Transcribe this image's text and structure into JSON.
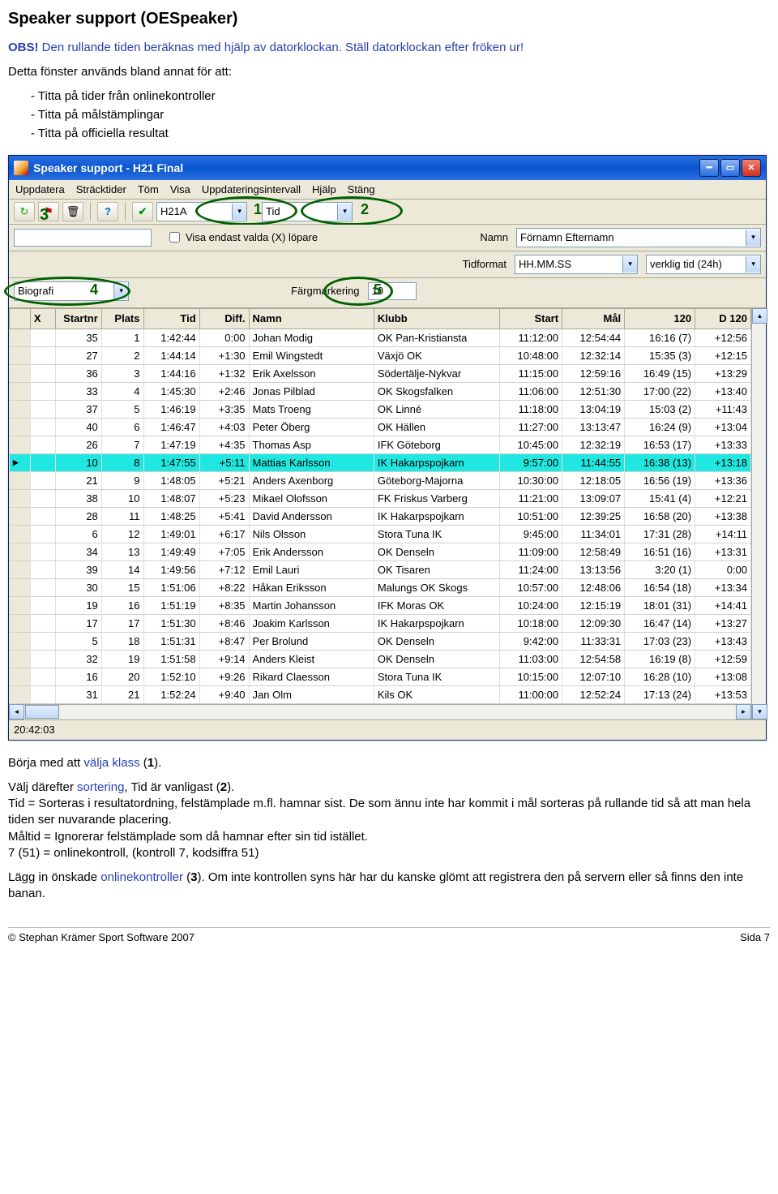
{
  "header": {
    "title": "Speaker support (OESpeaker)",
    "intro_prefix": "OBS!",
    "intro": " Den rullande tiden beräknas med hjälp av datorklockan. Ställ datorklockan efter fröken ur!",
    "para2": "Detta fönster används bland annat för att:",
    "bullets": [
      "Titta på tider från onlinekontroller",
      "Titta på målstämplingar",
      "Titta på officiella resultat"
    ]
  },
  "window": {
    "title": "Speaker support - H21 Final",
    "menu": [
      "Uppdatera",
      "Sträcktider",
      "Töm",
      "Visa",
      "Uppdateringsintervall",
      "Hjälp",
      "Stäng"
    ],
    "class_value": "H21A",
    "sort_value": "Tid",
    "filter_value": "",
    "chk_label": "Visa endast valda (X) löpare",
    "namn_label": "Namn",
    "namn_value": "Förnamn Efternamn",
    "tidformat_label": "Tidformat",
    "tidformat_value": "HH.MM.SS",
    "tid_mode_value": "verklig tid (24h)",
    "biografi_label": "Biografi",
    "farg_label": "Färgmarkering",
    "farg_value": "10",
    "status_time": "20:42:03",
    "columns": [
      "X",
      "Startnr",
      "Plats",
      "Tid",
      "Diff.",
      "Namn",
      "Klubb",
      "Start",
      "Mål",
      "120",
      "D 120"
    ],
    "rows": [
      {
        "sn": 35,
        "pl": 1,
        "tid": "1:42:44",
        "diff": "0:00",
        "namn": "Johan Modig",
        "klubb": "OK Pan-Kristiansta",
        "start": "11:12:00",
        "mal": "12:54:44",
        "c120": "16:16 (7)",
        "d120": "+12:56"
      },
      {
        "sn": 27,
        "pl": 2,
        "tid": "1:44:14",
        "diff": "+1:30",
        "namn": "Emil Wingstedt",
        "klubb": "Växjö OK",
        "start": "10:48:00",
        "mal": "12:32:14",
        "c120": "15:35 (3)",
        "d120": "+12:15"
      },
      {
        "sn": 36,
        "pl": 3,
        "tid": "1:44:16",
        "diff": "+1:32",
        "namn": "Erik Axelsson",
        "klubb": "Södertälje-Nykvar",
        "start": "11:15:00",
        "mal": "12:59:16",
        "c120": "16:49 (15)",
        "d120": "+13:29"
      },
      {
        "sn": 33,
        "pl": 4,
        "tid": "1:45:30",
        "diff": "+2:46",
        "namn": "Jonas Pilblad",
        "klubb": "OK Skogsfalken",
        "start": "11:06:00",
        "mal": "12:51:30",
        "c120": "17:00 (22)",
        "d120": "+13:40"
      },
      {
        "sn": 37,
        "pl": 5,
        "tid": "1:46:19",
        "diff": "+3:35",
        "namn": "Mats Troeng",
        "klubb": "OK Linné",
        "start": "11:18:00",
        "mal": "13:04:19",
        "c120": "15:03 (2)",
        "d120": "+11:43"
      },
      {
        "sn": 40,
        "pl": 6,
        "tid": "1:46:47",
        "diff": "+4:03",
        "namn": "Peter Öberg",
        "klubb": "OK Hällen",
        "start": "11:27:00",
        "mal": "13:13:47",
        "c120": "16:24 (9)",
        "d120": "+13:04"
      },
      {
        "sn": 26,
        "pl": 7,
        "tid": "1:47:19",
        "diff": "+4:35",
        "namn": "Thomas Asp",
        "klubb": "IFK Göteborg",
        "start": "10:45:00",
        "mal": "12:32:19",
        "c120": "16:53 (17)",
        "d120": "+13:33"
      },
      {
        "sn": 10,
        "pl": 8,
        "tid": "1:47:55",
        "diff": "+5:11",
        "namn": "Mattias Karlsson",
        "klubb": "IK Hakarpspojkarn",
        "start": "9:57:00",
        "mal": "11:44:55",
        "c120": "16:38 (13)",
        "d120": "+13:18",
        "sel": true
      },
      {
        "sn": 21,
        "pl": 9,
        "tid": "1:48:05",
        "diff": "+5:21",
        "namn": "Anders Axenborg",
        "klubb": "Göteborg-Majorna",
        "start": "10:30:00",
        "mal": "12:18:05",
        "c120": "16:56 (19)",
        "d120": "+13:36"
      },
      {
        "sn": 38,
        "pl": 10,
        "tid": "1:48:07",
        "diff": "+5:23",
        "namn": "Mikael Olofsson",
        "klubb": "FK Friskus Varberg",
        "start": "11:21:00",
        "mal": "13:09:07",
        "c120": "15:41 (4)",
        "d120": "+12:21"
      },
      {
        "sn": 28,
        "pl": 11,
        "tid": "1:48:25",
        "diff": "+5:41",
        "namn": "David Andersson",
        "klubb": "IK Hakarpspojkarn",
        "start": "10:51:00",
        "mal": "12:39:25",
        "c120": "16:58 (20)",
        "d120": "+13:38"
      },
      {
        "sn": 6,
        "pl": 12,
        "tid": "1:49:01",
        "diff": "+6:17",
        "namn": "Nils Olsson",
        "klubb": "Stora Tuna IK",
        "start": "9:45:00",
        "mal": "11:34:01",
        "c120": "17:31 (28)",
        "d120": "+14:11"
      },
      {
        "sn": 34,
        "pl": 13,
        "tid": "1:49:49",
        "diff": "+7:05",
        "namn": "Erik Andersson",
        "klubb": "OK Denseln",
        "start": "11:09:00",
        "mal": "12:58:49",
        "c120": "16:51 (16)",
        "d120": "+13:31"
      },
      {
        "sn": 39,
        "pl": 14,
        "tid": "1:49:56",
        "diff": "+7:12",
        "namn": "Emil Lauri",
        "klubb": "OK Tisaren",
        "start": "11:24:00",
        "mal": "13:13:56",
        "c120": "3:20 (1)",
        "d120": "0:00"
      },
      {
        "sn": 30,
        "pl": 15,
        "tid": "1:51:06",
        "diff": "+8:22",
        "namn": "Håkan Eriksson",
        "klubb": "Malungs OK Skogs",
        "start": "10:57:00",
        "mal": "12:48:06",
        "c120": "16:54 (18)",
        "d120": "+13:34"
      },
      {
        "sn": 19,
        "pl": 16,
        "tid": "1:51:19",
        "diff": "+8:35",
        "namn": "Martin Johansson",
        "klubb": "IFK Moras OK",
        "start": "10:24:00",
        "mal": "12:15:19",
        "c120": "18:01 (31)",
        "d120": "+14:41"
      },
      {
        "sn": 17,
        "pl": 17,
        "tid": "1:51:30",
        "diff": "+8:46",
        "namn": "Joakim Karlsson",
        "klubb": "IK Hakarpspojkarn",
        "start": "10:18:00",
        "mal": "12:09:30",
        "c120": "16:47 (14)",
        "d120": "+13:27"
      },
      {
        "sn": 5,
        "pl": 18,
        "tid": "1:51:31",
        "diff": "+8:47",
        "namn": "Per Brolund",
        "klubb": "OK Denseln",
        "start": "9:42:00",
        "mal": "11:33:31",
        "c120": "17:03 (23)",
        "d120": "+13:43"
      },
      {
        "sn": 32,
        "pl": 19,
        "tid": "1:51:58",
        "diff": "+9:14",
        "namn": "Anders Kleist",
        "klubb": "OK Denseln",
        "start": "11:03:00",
        "mal": "12:54:58",
        "c120": "16:19 (8)",
        "d120": "+12:59"
      },
      {
        "sn": 16,
        "pl": 20,
        "tid": "1:52:10",
        "diff": "+9:26",
        "namn": "Rikard Claesson",
        "klubb": "Stora Tuna IK",
        "start": "10:15:00",
        "mal": "12:07:10",
        "c120": "16:28 (10)",
        "d120": "+13:08"
      },
      {
        "sn": 31,
        "pl": 21,
        "tid": "1:52:24",
        "diff": "+9:40",
        "namn": "Jan Olm",
        "klubb": "Kils OK",
        "start": "11:00:00",
        "mal": "12:52:24",
        "c120": "17:13 (24)",
        "d120": "+13:53"
      }
    ]
  },
  "marks": {
    "n1": "1",
    "n2": "2",
    "n3": "3",
    "n4": "4",
    "n5": "5"
  },
  "body2": {
    "p1_a": "Börja med att ",
    "p1_link": "välja klass",
    "p1_b": " (",
    "p1_n": "1",
    "p1_c": ").",
    "p2_a": "Välj därefter ",
    "p2_link": "sortering",
    "p2_b": ", Tid är vanligast (",
    "p2_n": "2",
    "p2_c": ").",
    "p3_a": "Tid = Sorteras i resultatordning, felstämplade m.fl. hamnar sist. De som ännu inte har kommit i mål sorteras på rullande tid så att man hela tiden ser nuvarande placering.",
    "p3_b": "Måltid = Ignorerar felstämplade som då hamnar efter sin tid istället.",
    "p3_c": "7 (51) = onlinekontroll, (kontroll 7, kodsiffra 51)",
    "p4_a": "Lägg in önskade ",
    "p4_link": "onlinekontroller",
    "p4_b": " (",
    "p4_n": "3",
    "p4_c": "). Om inte kontrollen syns här har du kanske glömt att registrera den på servern eller så finns den inte banan."
  },
  "footer": {
    "left": "© Stephan Krämer Sport Software 2007",
    "right": "Sida 7"
  }
}
